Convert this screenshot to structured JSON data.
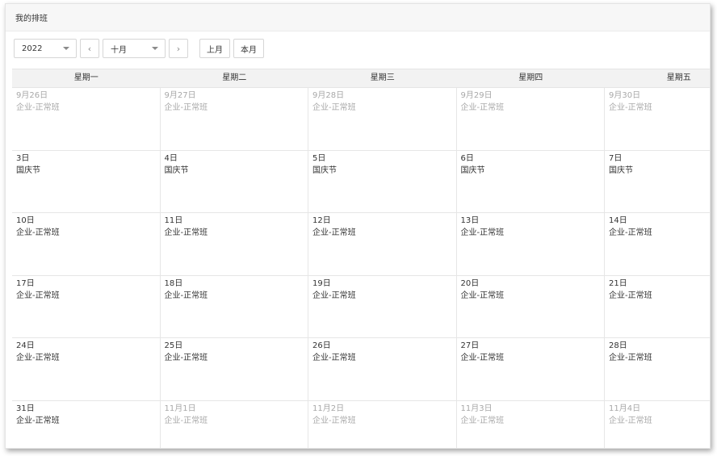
{
  "header": {
    "title": "我的排班"
  },
  "toolbar": {
    "year": "2022",
    "month": "十月",
    "prev_icon": "chevron-left-icon",
    "next_icon": "chevron-right-icon",
    "prev_month_label": "上月",
    "this_month_label": "本月"
  },
  "calendar": {
    "weekdays": [
      "星期一",
      "星期二",
      "星期三",
      "星期四",
      "星期五"
    ],
    "weeks": [
      [
        {
          "date": "9月26日",
          "shift": "企业-正常班",
          "other_month": true
        },
        {
          "date": "9月27日",
          "shift": "企业-正常班",
          "other_month": true
        },
        {
          "date": "9月28日",
          "shift": "企业-正常班",
          "other_month": true
        },
        {
          "date": "9月29日",
          "shift": "企业-正常班",
          "other_month": true
        },
        {
          "date": "9月30日",
          "shift": "企业-正常班",
          "other_month": true
        }
      ],
      [
        {
          "date": "3日",
          "shift": "国庆节",
          "other_month": false
        },
        {
          "date": "4日",
          "shift": "国庆节",
          "other_month": false
        },
        {
          "date": "5日",
          "shift": "国庆节",
          "other_month": false
        },
        {
          "date": "6日",
          "shift": "国庆节",
          "other_month": false
        },
        {
          "date": "7日",
          "shift": "国庆节",
          "other_month": false
        }
      ],
      [
        {
          "date": "10日",
          "shift": "企业-正常班",
          "other_month": false
        },
        {
          "date": "11日",
          "shift": "企业-正常班",
          "other_month": false
        },
        {
          "date": "12日",
          "shift": "企业-正常班",
          "other_month": false
        },
        {
          "date": "13日",
          "shift": "企业-正常班",
          "other_month": false
        },
        {
          "date": "14日",
          "shift": "企业-正常班",
          "other_month": false
        }
      ],
      [
        {
          "date": "17日",
          "shift": "企业-正常班",
          "other_month": false
        },
        {
          "date": "18日",
          "shift": "企业-正常班",
          "other_month": false
        },
        {
          "date": "19日",
          "shift": "企业-正常班",
          "other_month": false
        },
        {
          "date": "20日",
          "shift": "企业-正常班",
          "other_month": false
        },
        {
          "date": "21日",
          "shift": "企业-正常班",
          "other_month": false
        }
      ],
      [
        {
          "date": "24日",
          "shift": "企业-正常班",
          "other_month": false
        },
        {
          "date": "25日",
          "shift": "企业-正常班",
          "other_month": false
        },
        {
          "date": "26日",
          "shift": "企业-正常班",
          "other_month": false
        },
        {
          "date": "27日",
          "shift": "企业-正常班",
          "other_month": false
        },
        {
          "date": "28日",
          "shift": "企业-正常班",
          "other_month": false
        }
      ],
      [
        {
          "date": "31日",
          "shift": "企业-正常班",
          "other_month": false
        },
        {
          "date": "11月1日",
          "shift": "企业-正常班",
          "other_month": true
        },
        {
          "date": "11月2日",
          "shift": "企业-正常班",
          "other_month": true
        },
        {
          "date": "11月3日",
          "shift": "企业-正常班",
          "other_month": true
        },
        {
          "date": "11月4日",
          "shift": "企业-正常班",
          "other_month": true
        }
      ]
    ]
  }
}
